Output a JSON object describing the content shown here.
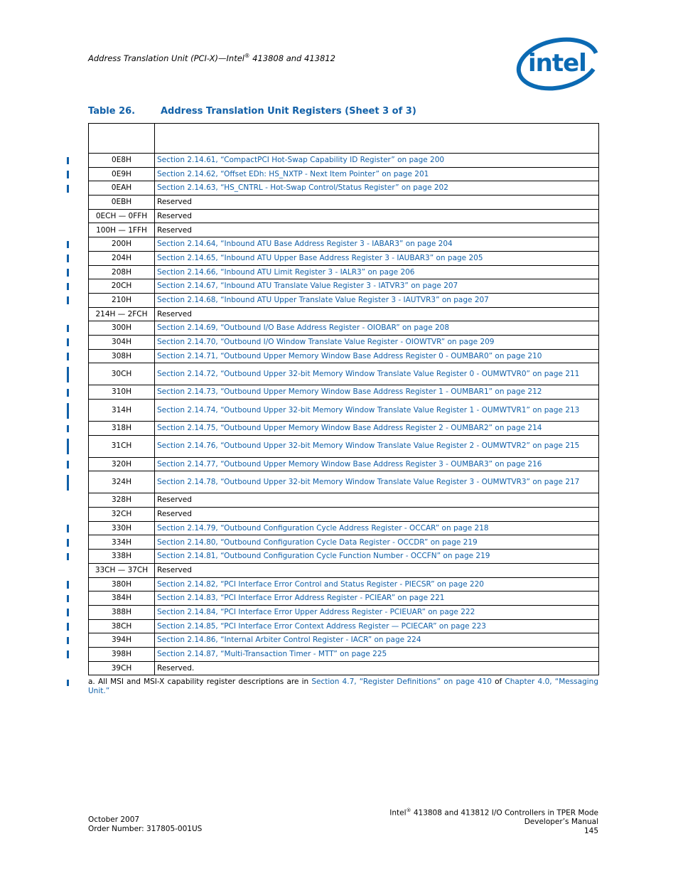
{
  "header": {
    "running_title": "Address Translation Unit (PCI-X)—Intel",
    "running_title_sup": "®",
    "running_title_tail": " 413808 and 413812",
    "logo": "intel-logo",
    "logo_text": "intel"
  },
  "table": {
    "number": "Table 26.",
    "title": "Address Translation Unit Registers  (Sheet 3 of 3)",
    "header_cells": [
      "",
      ""
    ],
    "rows": [
      {
        "offset": "0E8H",
        "description": "Section 2.14.61, “CompactPCI Hot-Swap Capability ID Register” on page 200",
        "link": true,
        "changed": true
      },
      {
        "offset": "0E9H",
        "description": "Section 2.14.62, “Offset EDh: HS_NXTP - Next Item Pointer” on page 201",
        "link": true,
        "changed": true
      },
      {
        "offset": "0EAH",
        "description": "Section 2.14.63, “HS_CNTRL - Hot-Swap Control/Status Register” on page 202",
        "link": true,
        "changed": true
      },
      {
        "offset": "0EBH",
        "description": "Reserved",
        "link": false,
        "changed": false
      },
      {
        "offset": "0ECH — 0FFH",
        "description": "Reserved",
        "link": false,
        "changed": false
      },
      {
        "offset": "100H — 1FFH",
        "description": "Reserved",
        "link": false,
        "changed": false
      },
      {
        "offset": "200H",
        "description": "Section 2.14.64, “Inbound ATU Base Address Register 3 - IABAR3” on page 204",
        "link": true,
        "changed": true
      },
      {
        "offset": "204H",
        "description": "Section 2.14.65, “Inbound ATU Upper Base Address Register 3 - IAUBAR3” on page 205",
        "link": true,
        "changed": true
      },
      {
        "offset": "208H",
        "description": "Section 2.14.66, “Inbound ATU Limit Register 3 - IALR3” on page 206",
        "link": true,
        "changed": true
      },
      {
        "offset": "20CH",
        "description": "Section 2.14.67, “Inbound ATU Translate Value Register 3 - IATVR3” on page 207",
        "link": true,
        "changed": true
      },
      {
        "offset": "210H",
        "description": "Section 2.14.68, “Inbound ATU Upper Translate Value Register 3 - IAUTVR3” on page 207",
        "link": true,
        "changed": true
      },
      {
        "offset": "214H —  2FCH",
        "description": "Reserved",
        "link": false,
        "changed": false
      },
      {
        "offset": "300H",
        "description": "Section 2.14.69, “Outbound I/O Base Address Register - OIOBAR” on page 208",
        "link": true,
        "changed": true
      },
      {
        "offset": "304H",
        "description": "Section 2.14.70, “Outbound I/O Window Translate Value Register - OIOWTVR” on page 209",
        "link": true,
        "changed": true
      },
      {
        "offset": "308H",
        "description": "Section 2.14.71, “Outbound Upper Memory Window Base Address Register 0 - OUMBAR0” on page 210",
        "link": true,
        "changed": true
      },
      {
        "offset": "30CH",
        "description": "Section 2.14.72, “Outbound Upper 32-bit Memory Window Translate Value Register 0 - OUMWTVR0” on page 211",
        "link": true,
        "changed": true,
        "tall": true
      },
      {
        "offset": "310H",
        "description": "Section 2.14.73, “Outbound Upper Memory Window Base Address Register 1 - OUMBAR1” on page 212",
        "link": true,
        "changed": true
      },
      {
        "offset": "314H",
        "description": "Section 2.14.74, “Outbound Upper 32-bit Memory Window Translate Value Register 1 - OUMWTVR1” on page 213",
        "link": true,
        "changed": true,
        "tall": true
      },
      {
        "offset": "318H",
        "description": "Section 2.14.75, “Outbound Upper Memory Window Base Address Register 2 - OUMBAR2” on page 214",
        "link": true,
        "changed": true
      },
      {
        "offset": "31CH",
        "description": "Section 2.14.76, “Outbound Upper 32-bit Memory Window Translate Value Register 2 - OUMWTVR2” on page 215",
        "link": true,
        "changed": true,
        "tall": true
      },
      {
        "offset": "320H",
        "description": "Section 2.14.77, “Outbound Upper Memory Window Base Address Register 3 - OUMBAR3” on page 216",
        "link": true,
        "changed": true
      },
      {
        "offset": "324H",
        "description": "Section 2.14.78, “Outbound Upper 32-bit Memory Window Translate Value Register 3 - OUMWTVR3” on page 217",
        "link": true,
        "changed": true,
        "tall": true
      },
      {
        "offset": "328H",
        "description": "Reserved",
        "link": false,
        "changed": false
      },
      {
        "offset": "32CH",
        "description": "Reserved",
        "link": false,
        "changed": false
      },
      {
        "offset": "330H",
        "description": "Section 2.14.79, “Outbound Configuration Cycle Address Register - OCCAR” on page 218",
        "link": true,
        "changed": true
      },
      {
        "offset": "334H",
        "description": "Section 2.14.80, “Outbound Configuration Cycle Data Register - OCCDR” on page 219",
        "link": true,
        "changed": true
      },
      {
        "offset": "338H",
        "description": "Section 2.14.81, “Outbound Configuration Cycle Function Number - OCCFN” on page 219",
        "link": true,
        "changed": true
      },
      {
        "offset": "33CH — 37CH",
        "description": "Reserved",
        "link": false,
        "changed": false
      },
      {
        "offset": "380H",
        "description": "Section 2.14.82, “PCI Interface Error Control and Status Register - PIECSR” on page 220",
        "link": true,
        "changed": true
      },
      {
        "offset": "384H",
        "description": "Section 2.14.83, “PCI Interface Error Address Register - PCIEAR” on page 221",
        "link": true,
        "changed": true
      },
      {
        "offset": "388H",
        "description": "Section 2.14.84, “PCI Interface Error Upper Address Register - PCIEUAR” on page 222",
        "link": true,
        "changed": true
      },
      {
        "offset": "38CH",
        "description": "Section 2.14.85, “PCI Interface Error Context Address Register — PCIECAR” on page 223",
        "link": true,
        "changed": true
      },
      {
        "offset": "394H",
        "description": "Section 2.14.86, “Internal Arbiter Control Register - IACR” on page 224",
        "link": true,
        "changed": true
      },
      {
        "offset": "398H",
        "description": "Section 2.14.87, “Multi-Transaction Timer - MTT” on page 225",
        "link": true,
        "changed": true
      },
      {
        "offset": "39CH",
        "description": "Reserved.",
        "link": false,
        "changed": false
      }
    ]
  },
  "footnote": {
    "prefix": "a. All MSI and MSI-X capability register descriptions are in ",
    "link1": "Section 4.7, “Register Definitions” on page 410",
    "middle": " of ",
    "link2": "Chapter 4.0, “Messaging Unit.”",
    "changed": true
  },
  "footer": {
    "date": "October 2007",
    "order_number": "Order Number: 317805-001US",
    "product_prefix": "Intel",
    "product_sup": "®",
    "product_tail": " 413808 and 413812 I/O Controllers in TPER Mode",
    "manual": "Developer’s Manual",
    "page_number": "145"
  },
  "colors": {
    "accent": "#1160a8",
    "text": "#000000"
  }
}
